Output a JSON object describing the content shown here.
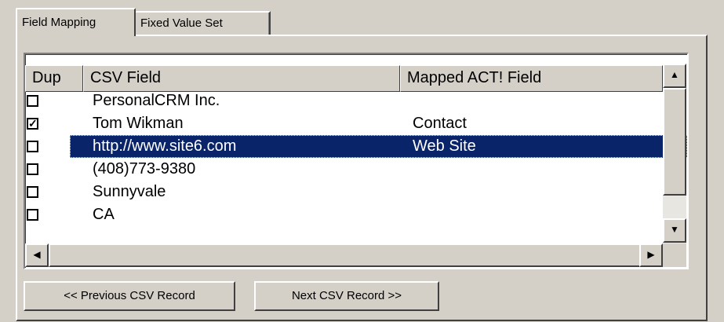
{
  "tabs": [
    {
      "label": "Field Mapping",
      "active": true
    },
    {
      "label": "Fixed Value Set",
      "active": false
    }
  ],
  "list": {
    "columns": [
      "Dup",
      "CSV Field",
      "Mapped ACT! Field"
    ],
    "rows": [
      {
        "dup": false,
        "csv": "PersonalCRM Inc.",
        "act": ""
      },
      {
        "dup": true,
        "csv": "Tom Wikman",
        "act": "Contact"
      },
      {
        "dup": false,
        "csv": "http://www.site6.com",
        "act": "Web Site",
        "selected": true
      },
      {
        "dup": false,
        "csv": "(408)773-9380",
        "act": ""
      },
      {
        "dup": false,
        "csv": "Sunnyvale",
        "act": ""
      },
      {
        "dup": false,
        "csv": "CA",
        "act": ""
      }
    ]
  },
  "buttons": {
    "previous": "<< Previous CSV Record",
    "next": "Next CSV Record >>"
  },
  "icons": {
    "checked_mark": "✓",
    "scroll_up": "▲",
    "scroll_down": "▼",
    "scroll_left": "◀",
    "scroll_right": "▶"
  },
  "colors": {
    "selection": "#0a246a",
    "face": "#d4d0c8"
  }
}
